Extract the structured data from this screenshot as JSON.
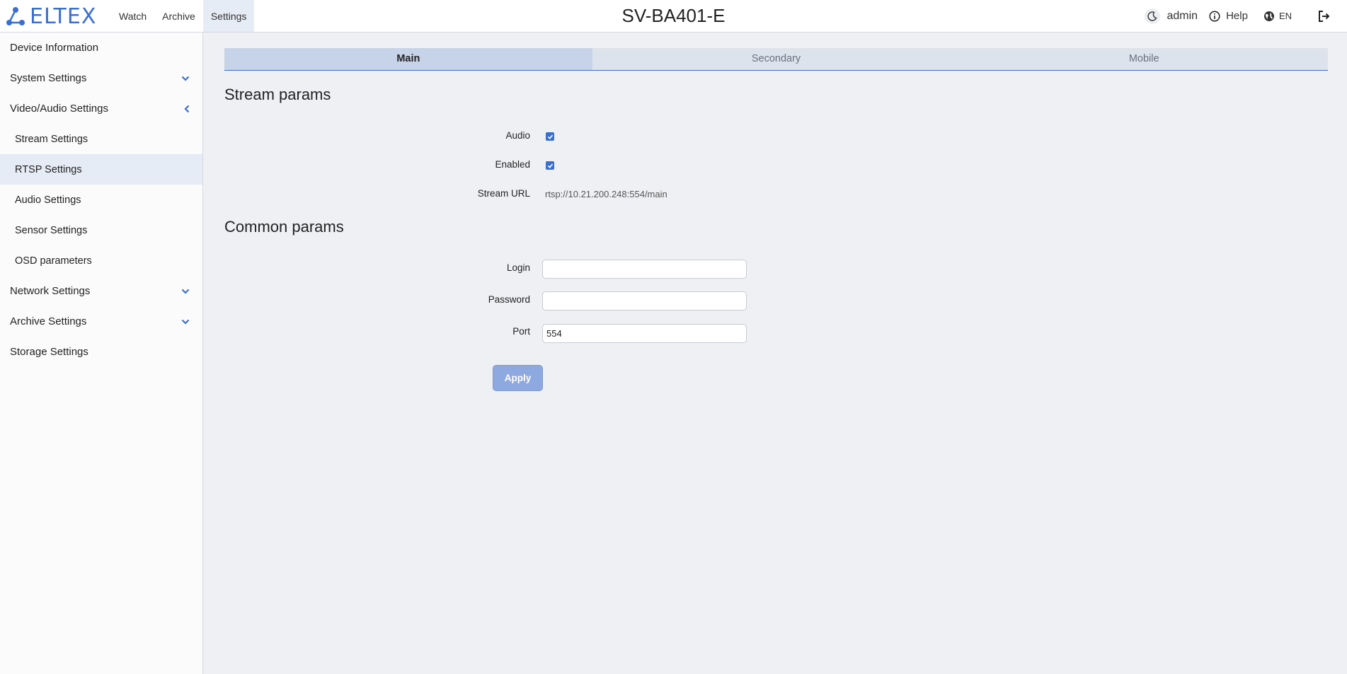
{
  "header": {
    "logo_text": "ELTEX",
    "nav": [
      {
        "label": "Watch"
      },
      {
        "label": "Archive"
      },
      {
        "label": "Settings",
        "active": true
      }
    ],
    "device_title": "SV-BA401-E",
    "user": "admin",
    "help_label": "Help",
    "language": "EN"
  },
  "sidebar": {
    "items": [
      {
        "label": "Device Information"
      },
      {
        "label": "System Settings",
        "chevron": "chevron-down-icon"
      },
      {
        "label": "Video/Audio Settings",
        "chevron": "chevron-left-icon"
      },
      {
        "label": "Stream Settings",
        "sub": true
      },
      {
        "label": "RTSP Settings",
        "sub": true,
        "active": true
      },
      {
        "label": "Audio Settings",
        "sub": true
      },
      {
        "label": "Sensor Settings",
        "sub": true
      },
      {
        "label": "OSD parameters",
        "sub": true
      },
      {
        "label": "Network Settings",
        "chevron": "chevron-down-icon"
      },
      {
        "label": "Archive Settings",
        "chevron": "chevron-down-icon"
      },
      {
        "label": "Storage Settings"
      }
    ]
  },
  "tabs": [
    {
      "label": "Main",
      "active": true
    },
    {
      "label": "Secondary"
    },
    {
      "label": "Mobile"
    }
  ],
  "stream_params": {
    "title": "Stream params",
    "audio_label": "Audio",
    "audio_checked": true,
    "enabled_label": "Enabled",
    "enabled_checked": true,
    "stream_url_label": "Stream URL",
    "stream_url": "rtsp://10.21.200.248:554/main"
  },
  "common_params": {
    "title": "Common params",
    "login_label": "Login",
    "login_value": "",
    "password_label": "Password",
    "password_value": "",
    "port_label": "Port",
    "port_value": "554"
  },
  "apply_label": "Apply",
  "colors": {
    "accent": "#3a6fd0",
    "active_bg": "#e6ecf5",
    "tab_active_bg": "#c6d3e8",
    "apply_bg": "#8ea8e0"
  }
}
